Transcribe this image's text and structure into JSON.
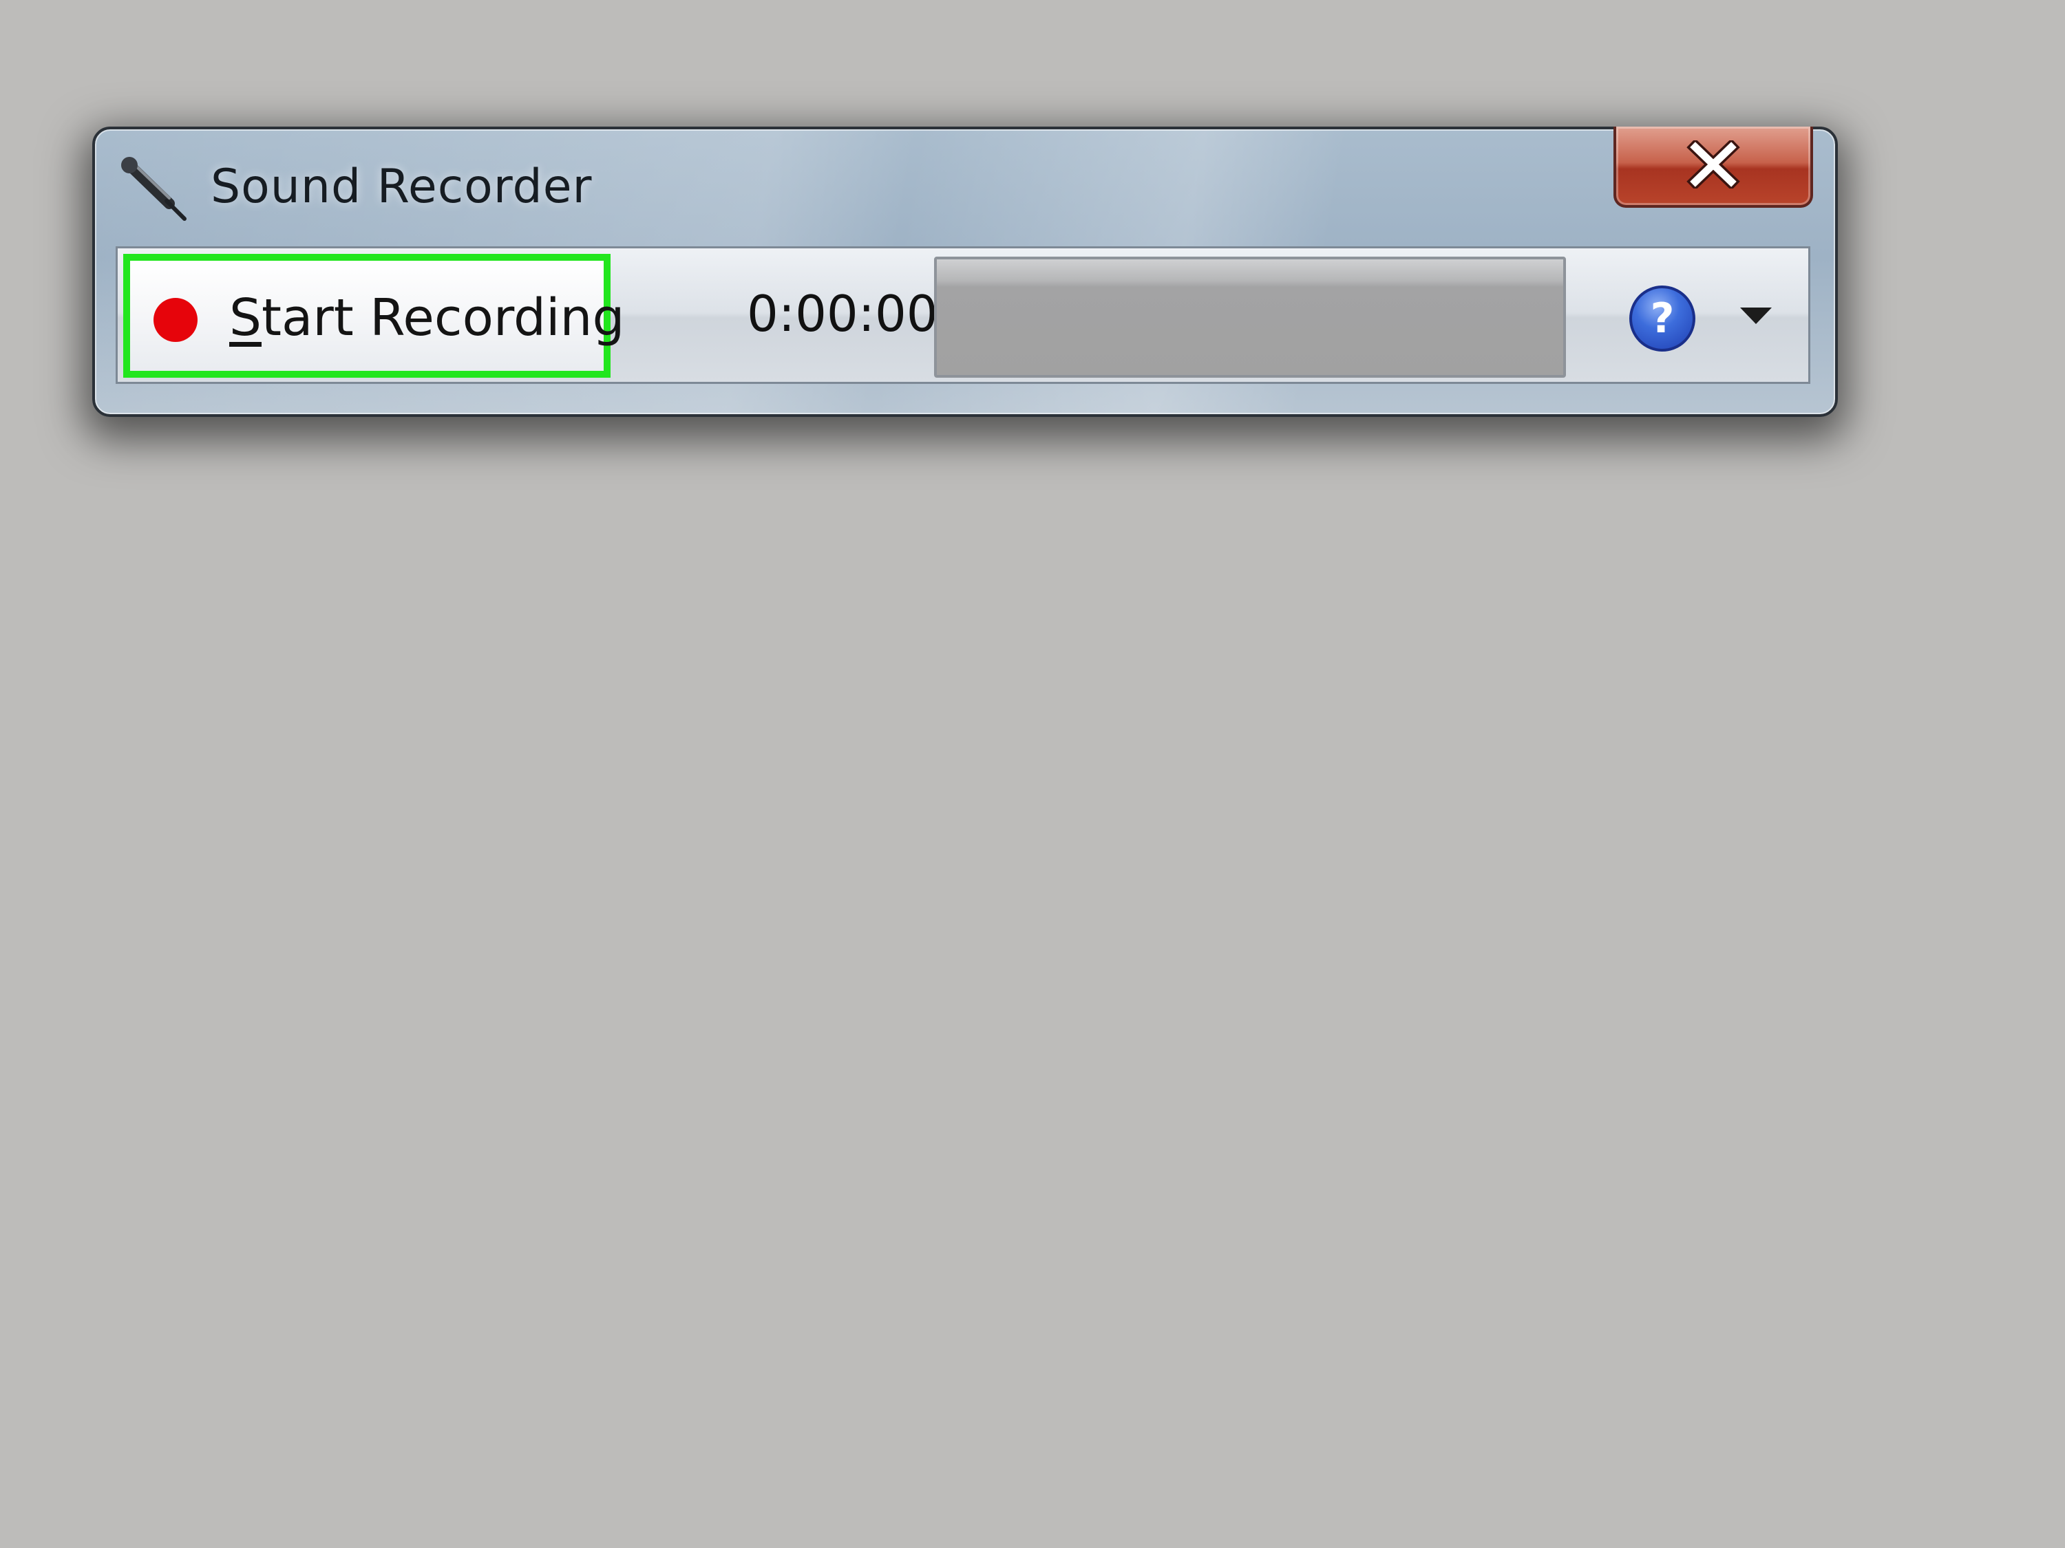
{
  "window": {
    "title": "Sound Recorder",
    "title_icon": "microphone-icon",
    "close_icon": "close-icon"
  },
  "toolbar": {
    "record_button": {
      "label_first": "S",
      "label_rest": "tart Recording",
      "icon": "record-dot-icon",
      "icon_color": "#e6040b",
      "highlight_color": "#22e61e"
    },
    "elapsed_time": "0:00:00",
    "level_meter": {
      "level_percent": 0
    },
    "help": {
      "glyph": "?",
      "icon": "help-icon"
    },
    "dropdown_icon": "chevron-down-icon"
  }
}
